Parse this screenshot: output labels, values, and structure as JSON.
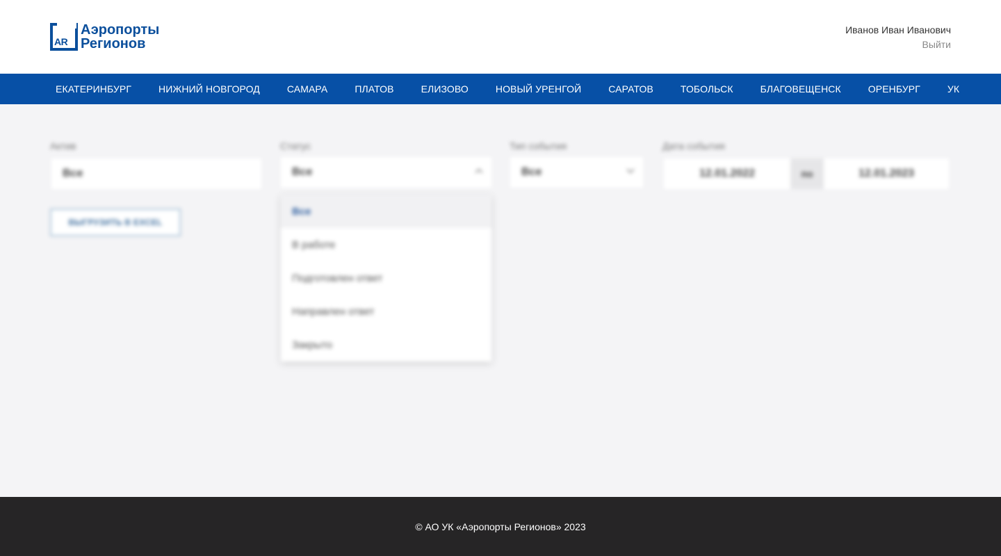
{
  "brand": {
    "logo_mark": "AR",
    "line1": "Аэропорты",
    "line2": "Регионов",
    "color": "#0b4f9c"
  },
  "user": {
    "name": "Иванов Иван Иванович",
    "logout": "Выйти"
  },
  "nav": {
    "color": "#0750a6",
    "items": [
      "ЕКАТЕРИНБУРГ",
      "НИЖНИЙ НОВГОРОД",
      "САМАРА",
      "ПЛАТОВ",
      "ЕЛИЗОВО",
      "НОВЫЙ УРЕНГОЙ",
      "САРАТОВ",
      "ТОБОЛЬСК",
      "БЛАГОВЕЩЕНСК",
      "ОРЕНБУРГ",
      "УК"
    ]
  },
  "filters": {
    "asset": {
      "label": "Актив",
      "value": "Все"
    },
    "status": {
      "label": "Статус",
      "value": "Все",
      "options": [
        "Все",
        "В работе",
        "Подготовлен ответ",
        "Направлен ответ",
        "Закрыто"
      ]
    },
    "event_type": {
      "label": "Тип события",
      "value": "Все"
    },
    "event_date": {
      "label": "Дата события",
      "from": "12.01.2022",
      "separator": "по",
      "to": "12.01.2023"
    }
  },
  "export_button": "ВЫГРУЗИТЬ В EXCEL",
  "footer": {
    "text": "© АО УК «Аэропорты Регионов» 2023"
  }
}
